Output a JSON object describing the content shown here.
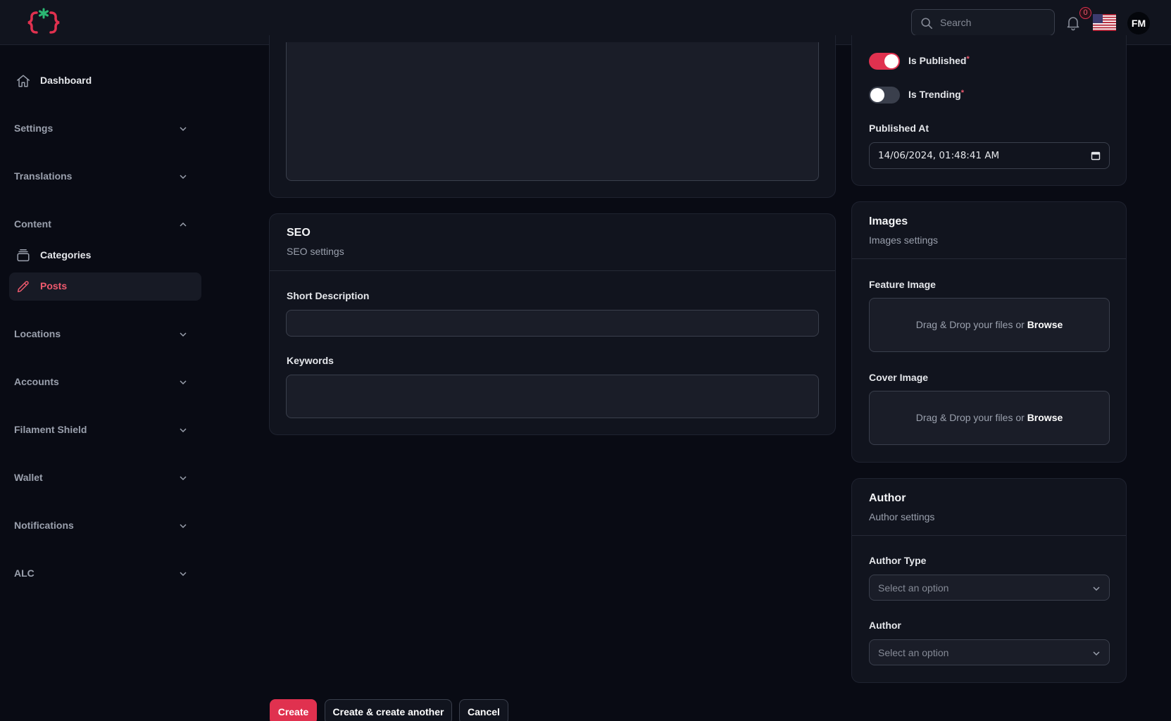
{
  "colors": {
    "accent": "#e0314f",
    "background": "#090b14",
    "panel": "#11141e"
  },
  "topbar": {
    "logo_icon": "curly-braces-asterisk-logo",
    "search": {
      "placeholder": "Search",
      "icon": "search-icon"
    },
    "notifications": {
      "icon": "bell-icon",
      "count": "0"
    },
    "language_flag": "us-flag-icon",
    "avatar_initials": "FM"
  },
  "sidebar": {
    "items": [
      {
        "label": "Dashboard",
        "icon": "home-icon",
        "type": "link"
      },
      {
        "label": "Settings",
        "type": "group",
        "expanded": false
      },
      {
        "label": "Translations",
        "type": "group",
        "expanded": false
      },
      {
        "label": "Content",
        "type": "group",
        "expanded": true,
        "children": [
          {
            "label": "Categories",
            "icon": "stack-icon"
          },
          {
            "label": "Posts",
            "icon": "pencil-icon",
            "active": true
          }
        ]
      },
      {
        "label": "Locations",
        "type": "group",
        "expanded": false
      },
      {
        "label": "Accounts",
        "type": "group",
        "expanded": false
      },
      {
        "label": "Filament Shield",
        "type": "group",
        "expanded": false
      },
      {
        "label": "Wallet",
        "type": "group",
        "expanded": false
      },
      {
        "label": "Notifications",
        "type": "group",
        "expanded": false
      },
      {
        "label": "ALC",
        "type": "group",
        "expanded": false
      }
    ]
  },
  "seo": {
    "title": "SEO",
    "description": "SEO settings",
    "short_description_label": "Short Description",
    "keywords_label": "Keywords"
  },
  "status": {
    "is_published_label": "Is Published",
    "is_published": true,
    "is_trending_label": "Is Trending",
    "is_trending": false,
    "required_mark": "*",
    "published_at_label": "Published At",
    "published_at_value": "14/06/2024, 01:48:41 AM"
  },
  "images": {
    "title": "Images",
    "description": "Images settings",
    "feature_image_label": "Feature Image",
    "cover_image_label": "Cover Image",
    "drop_text": "Drag & Drop your files or ",
    "browse_text": "Browse"
  },
  "author": {
    "title": "Author",
    "description": "Author settings",
    "author_type_label": "Author Type",
    "author_label": "Author",
    "select_placeholder": "Select an option"
  },
  "actions": {
    "create": "Create",
    "create_another": "Create & create another",
    "cancel": "Cancel"
  }
}
